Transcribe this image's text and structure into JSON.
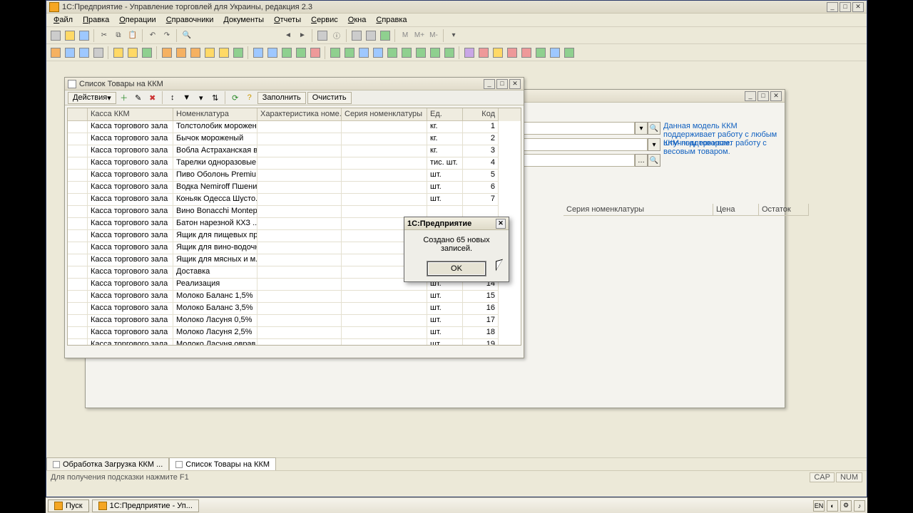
{
  "window": {
    "title": "1С:Предприятие - Управление торговлей для Украины, редакция 2.3",
    "menu": [
      "Файл",
      "Правка",
      "Операции",
      "Справочники",
      "Документы",
      "Отчеты",
      "Сервис",
      "Окна",
      "Справка"
    ]
  },
  "back_window": {
    "right_notes": [
      "Данная модель ККМ поддерживает работу с любым штучным товаром.",
      "ККМ поддерживает работу с весовым товаром."
    ],
    "columns_right": [
      "Серия номенклатуры",
      "Цена",
      "Остаток"
    ]
  },
  "list_window": {
    "title": "Список Товары на ККМ",
    "actions_label": "Действия",
    "btn_fill": "Заполнить",
    "btn_clear": "Очистить",
    "columns": [
      "",
      "Касса ККМ",
      "Номенклатура",
      "Характеристика номе...",
      "Серия номенклатуры",
      "Ед.",
      "Код"
    ],
    "rows": [
      {
        "kassa": "Касса торгового зала",
        "nom": "Толстолобик морожен...",
        "ed": "кг.",
        "kod": "1"
      },
      {
        "kassa": "Касса торгового зала",
        "nom": "Бычок мороженый",
        "ed": "кг.",
        "kod": "2"
      },
      {
        "kassa": "Касса торгового зала",
        "nom": "Вобла Астраханская в...",
        "ed": "кг.",
        "kod": "3"
      },
      {
        "kassa": "Касса торгового зала",
        "nom": "Тарелки одноразовые",
        "ed": "тис. шт.",
        "kod": "4"
      },
      {
        "kassa": "Касса торгового зала",
        "nom": "Пиво Оболонь Premiu...",
        "ed": "шт.",
        "kod": "5"
      },
      {
        "kassa": "Касса торгового зала",
        "nom": "Водка Nemiroff Пшенич...",
        "ed": "шт.",
        "kod": "6"
      },
      {
        "kassa": "Касса торгового зала",
        "nom": "Коньяк Одесса Шусто...",
        "ed": "шт.",
        "kod": "7"
      },
      {
        "kassa": "Касса торгового зала",
        "nom": "Вино Bonacchi Montep...",
        "ed": "",
        "kod": ""
      },
      {
        "kassa": "Касса торгового зала",
        "nom": "Батон нарезной КХЗ ...",
        "ed": "",
        "kod": ""
      },
      {
        "kassa": "Касса торгового зала",
        "nom": "Ящик для пищевых пр...",
        "ed": "",
        "kod": ""
      },
      {
        "kassa": "Касса торгового зала",
        "nom": "Ящик для вино-водочн...",
        "ed": "",
        "kod": ""
      },
      {
        "kassa": "Касса торгового зала",
        "nom": "Ящик для мясных и м...",
        "ed": "",
        "kod": ""
      },
      {
        "kassa": "Касса торгового зала",
        "nom": "Доставка",
        "ed": "",
        "kod": ""
      },
      {
        "kassa": "Касса торгового зала",
        "nom": "Реализация",
        "ed": "шт.",
        "kod": "14"
      },
      {
        "kassa": "Касса торгового зала",
        "nom": "Молоко Баланс 1,5%",
        "ed": "шт.",
        "kod": "15"
      },
      {
        "kassa": "Касса торгового зала",
        "nom": "Молоко Баланс 3,5%",
        "ed": "шт.",
        "kod": "16"
      },
      {
        "kassa": "Касса торгового зала",
        "nom": "Молоко Ласуня 0,5%",
        "ed": "шт.",
        "kod": "17"
      },
      {
        "kassa": "Касса торгового зала",
        "nom": "Молоко Ласуня 2,5%",
        "ed": "шт.",
        "kod": "18"
      },
      {
        "kassa": "Касса торгового зала",
        "nom": "Молоко Ласуня оврав",
        "ed": "шт.",
        "kod": "19"
      }
    ]
  },
  "dialog": {
    "title": "1С:Предприятие",
    "text": "Создано 65 новых записей.",
    "ok": "OK"
  },
  "tabs": [
    {
      "label": "Обработка  Загрузка ККМ ...",
      "active": false
    },
    {
      "label": "Список Товары на ККМ",
      "active": true
    }
  ],
  "status": {
    "hint": "Для получения подсказки нажмите F1",
    "cap": "CAP",
    "num": "NUM"
  },
  "taskbar": {
    "start": "Пуск",
    "app": "1С:Предприятие - Уп...",
    "lang": "EN"
  }
}
